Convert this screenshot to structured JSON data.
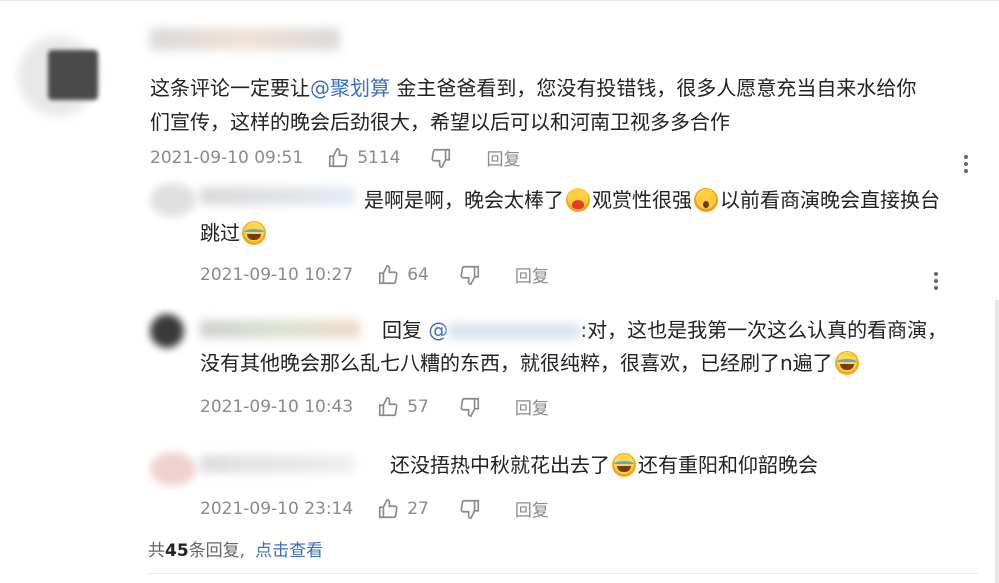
{
  "comment": {
    "text_line1_pre": "这条评论一定要让",
    "mention": "@聚划算",
    "text_line1_post": "  金主爸爸看到，您没有投错钱，很多人愿意充当自来水给你",
    "text_line2": "们宣传，这样的晚会后劲很大，希望以后可以和河南卫视多多合作",
    "date": "2021-09-10 09:51",
    "likes": "5114",
    "reply_label": "回复"
  },
  "replies": [
    {
      "text_a": "是啊是啊，晚会太棒了",
      "text_b": "观赏性很强",
      "text_c": "以前看商演晚会直接换台",
      "text_line2": "跳过",
      "date": "2021-09-10 10:27",
      "likes": "64",
      "reply_label": "回复"
    },
    {
      "prefix": "回复 ",
      "mention": "@",
      "text_line1_post": ":对，这也是我第一次这么认真的看商演，",
      "text_line2": "没有其他晚会那么乱七八糟的东西，就很纯粹，很喜欢，已经刷了n遍了",
      "date": "2021-09-10 10:43",
      "likes": "57",
      "reply_label": "回复"
    },
    {
      "text_a": "还没捂热中秋就花出去了",
      "text_b": "还有重阳和仰韶晚会",
      "date": "2021-09-10 23:14",
      "likes": "27",
      "reply_label": "回复"
    }
  ],
  "footer": {
    "prefix": "共",
    "count": "45",
    "suffix": "条回复,",
    "link": "点击查看"
  },
  "icons": {
    "like": "thumbs-up-icon",
    "dislike": "thumbs-down-icon",
    "more": "more-vertical-icon"
  },
  "colors": {
    "link": "#3a6fc1",
    "meta": "#8a8a8a"
  }
}
